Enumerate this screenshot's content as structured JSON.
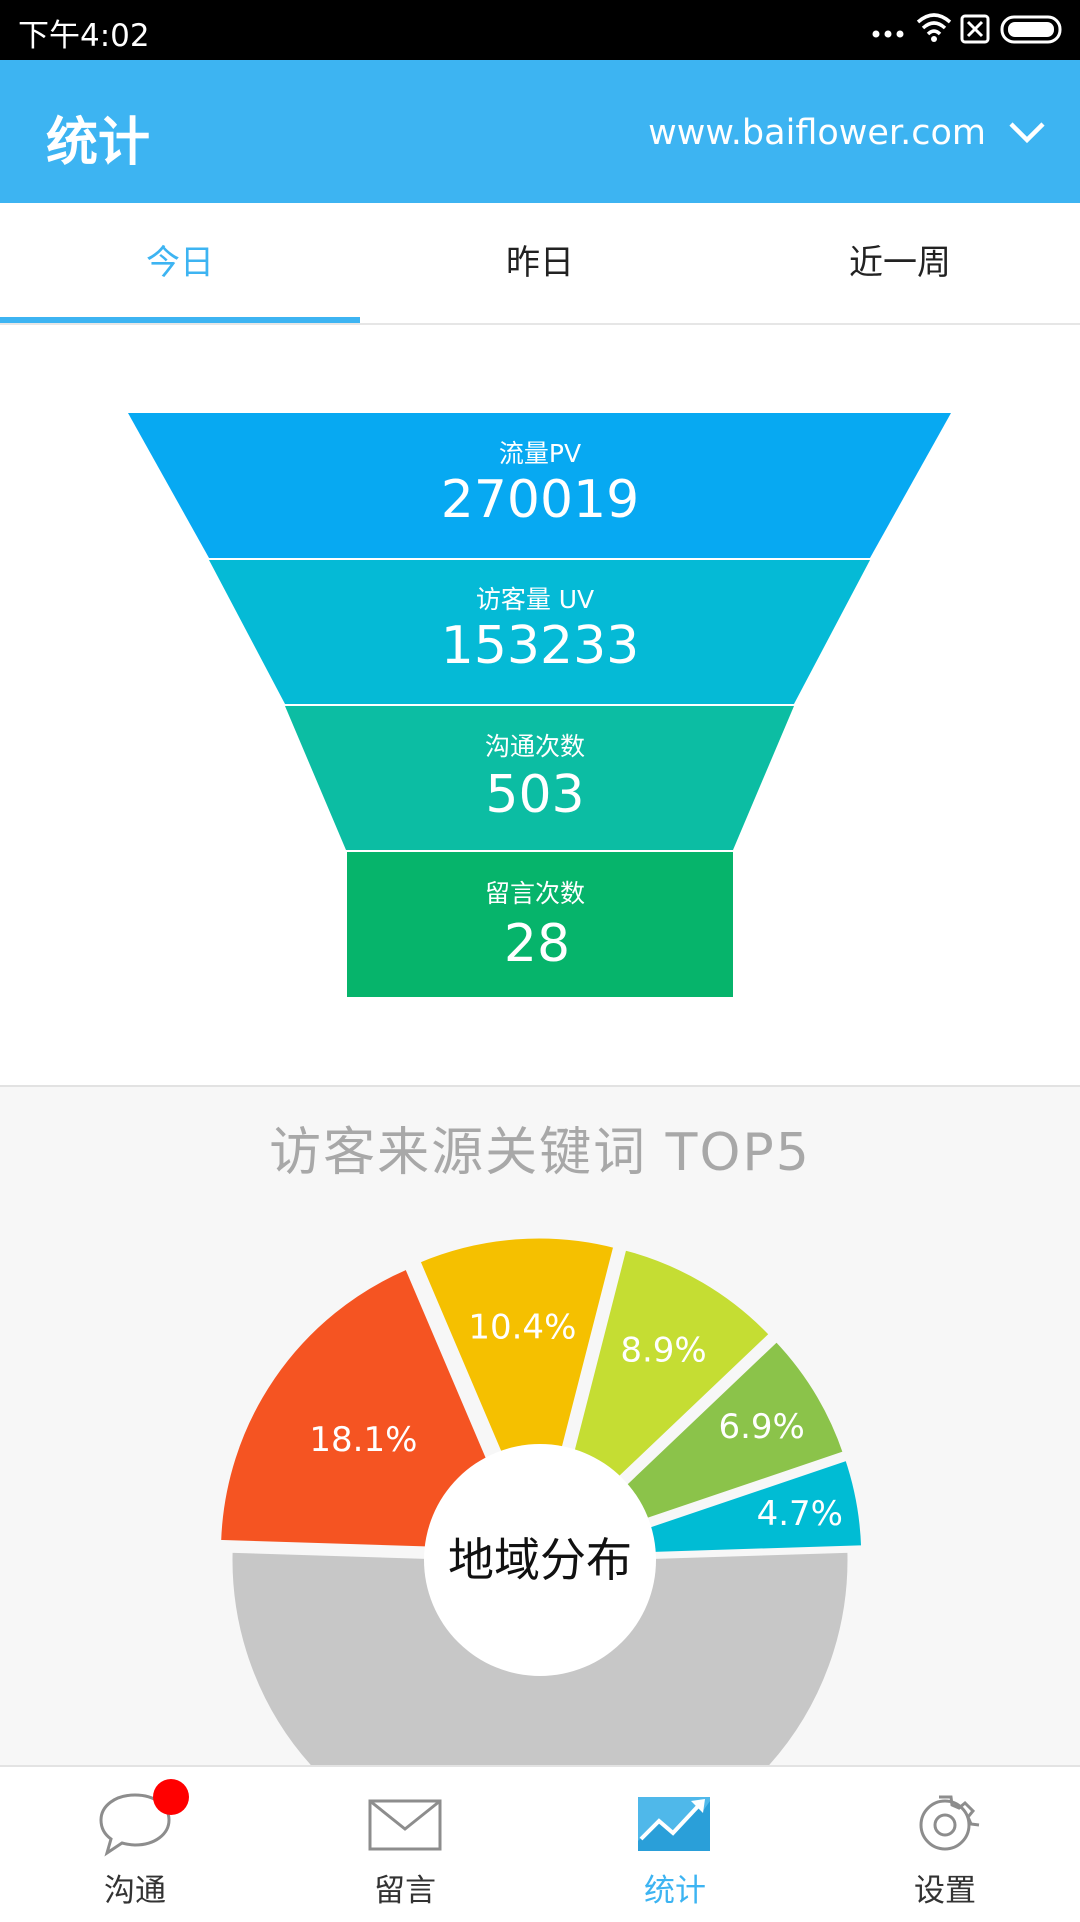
{
  "status_bar": {
    "time": "下午4:02"
  },
  "header": {
    "title": "统计",
    "site": "www.baiflower.com",
    "site_icon": "chevron-down-icon"
  },
  "tabs": [
    {
      "label": "今日",
      "active": true
    },
    {
      "label": "昨日",
      "active": false
    },
    {
      "label": "近一周",
      "active": false
    }
  ],
  "funnel": {
    "stages": [
      {
        "label": "流量PV",
        "value": "270019",
        "color": "#07a9f2"
      },
      {
        "label": "访客量 UV",
        "value": "153233",
        "color": "#05bad6"
      },
      {
        "label": "沟通次数",
        "value": "503",
        "color": "#0cbda3"
      },
      {
        "label": "留言次数",
        "value": "28",
        "color": "#06b46b"
      }
    ]
  },
  "keywords_panel": {
    "title": "访客来源关键词 TOP5",
    "center_label": "地域分布"
  },
  "chart_data": {
    "type": "pie",
    "title": "访客来源关键词 TOP5",
    "center_label": "地域分布",
    "slices": [
      {
        "label": "51%",
        "value": 51,
        "color": "#c7c7c7"
      },
      {
        "label": "18.1%",
        "value": 18.1,
        "color": "#f55422"
      },
      {
        "label": "10.4%",
        "value": 10.4,
        "color": "#f5c000"
      },
      {
        "label": "8.9%",
        "value": 8.9,
        "color": "#c5dd33"
      },
      {
        "label": "6.9%",
        "value": 6.9,
        "color": "#8bc34a"
      },
      {
        "label": "4.7%",
        "value": 4.7,
        "color": "#00bcd4"
      }
    ]
  },
  "bottom_nav": [
    {
      "label": "沟通",
      "icon": "chat-bubble-icon",
      "active": false,
      "has_badge": true
    },
    {
      "label": "留言",
      "icon": "envelope-icon",
      "active": false,
      "has_badge": false
    },
    {
      "label": "统计",
      "icon": "trend-chart-icon",
      "active": true,
      "has_badge": false
    },
    {
      "label": "设置",
      "icon": "gear-icon",
      "active": false,
      "has_badge": false
    }
  ],
  "colors": {
    "accent": "#3db4f2",
    "badge": "#ff0000"
  }
}
